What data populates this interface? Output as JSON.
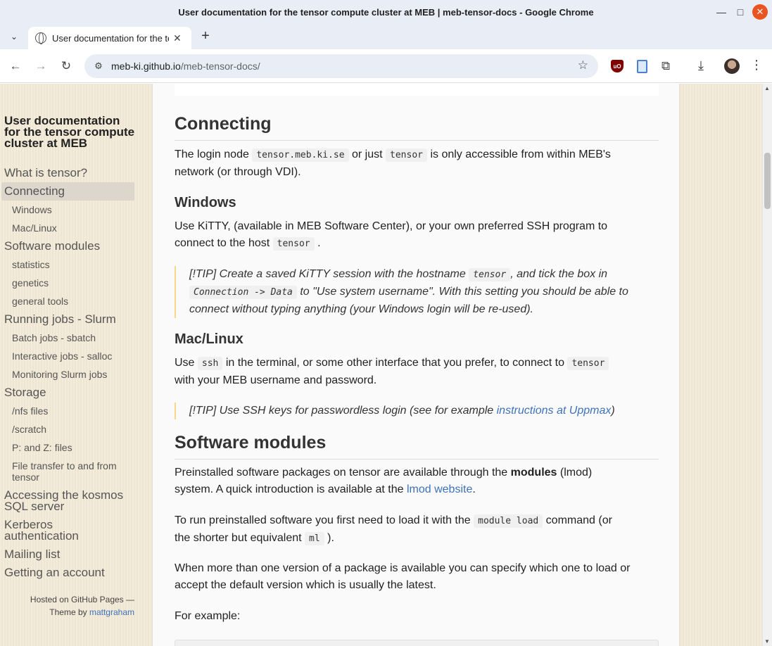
{
  "window": {
    "title": "User documentation for the tensor compute cluster at MEB | meb-tensor-docs - Google Chrome",
    "minimize": "—",
    "maximize": "□",
    "close": "✕"
  },
  "tabs": [
    {
      "title": "User documentation for the tensor compute cluster at MEB",
      "close": "✕"
    }
  ],
  "new_tab": "+",
  "toolbar": {
    "back": "←",
    "forward": "→",
    "reload": "↻",
    "url_host": "meb-ki.github.io",
    "url_path": "/meb-tensor-docs/",
    "bookmark": "☆",
    "ublock_label": "uO",
    "extensions": "⧉",
    "download": "⤓",
    "menu": "⋮"
  },
  "sidebar": {
    "title": "User documentation for the tensor compute cluster at MEB",
    "items": [
      {
        "label": "What is tensor?",
        "level": 1
      },
      {
        "label": "Connecting",
        "level": 1,
        "active": true
      },
      {
        "label": "Windows",
        "level": 2
      },
      {
        "label": "Mac/Linux",
        "level": 2
      },
      {
        "label": "Software modules",
        "level": 1
      },
      {
        "label": "statistics",
        "level": 2
      },
      {
        "label": "genetics",
        "level": 2
      },
      {
        "label": "general tools",
        "level": 2
      },
      {
        "label": "Running jobs - Slurm",
        "level": 1
      },
      {
        "label": "Batch jobs - sbatch",
        "level": 2
      },
      {
        "label": "Interactive jobs - salloc",
        "level": 2
      },
      {
        "label": "Monitoring Slurm jobs",
        "level": 2
      },
      {
        "label": "Storage",
        "level": 1
      },
      {
        "label": "/nfs files",
        "level": 2
      },
      {
        "label": "/scratch",
        "level": 2
      },
      {
        "label": "P: and Z: files",
        "level": 2
      },
      {
        "label": "File transfer to and from tensor",
        "level": 2
      },
      {
        "label": "Accessing the kosmos SQL server",
        "level": 1
      },
      {
        "label": "Kerberos authentication",
        "level": 1
      },
      {
        "label": "Mailing list",
        "level": 1
      },
      {
        "label": "Getting an account",
        "level": 1
      }
    ],
    "footer_line1": "Hosted on GitHub Pages —",
    "footer_theme_prefix": "Theme by",
    "footer_theme_link": "mattgraham"
  },
  "content": {
    "connecting_heading": "Connecting",
    "connecting_p1": "The login node",
    "code_tensor_fqdn": "tensor.meb.ki.se",
    "connecting_p2": "or just",
    "code_tensor": "tensor",
    "connecting_p3": "is only accessible from within MEB's",
    "connecting_p4": "network (or through VDI).",
    "windows_heading": "Windows",
    "windows_p1": "Use KiTTY, (available in MEB Software Center), or your own preferred SSH program to",
    "windows_p2": "connect to the host",
    "windows_p3": ".",
    "tip1_a": "[!TIP] Create a saved KiTTY session with the hostname",
    "tip1_b": ", and tick the box in",
    "code_connection_data": "Connection -> Data",
    "tip1_c": "to \"Use system username\". With this setting you should be able to",
    "tip1_d": "connect without typing anything (your Windows login will be re-used).",
    "mac_heading": "Mac/Linux",
    "mac_p1": "Use",
    "code_ssh": "ssh",
    "mac_p2": "in the terminal, or some other interface that you prefer, to connect to",
    "mac_p3": "with your MEB username and password.",
    "tip2_a": "[!TIP] Use SSH keys for passwordless login (see for example",
    "tip2_link": "instructions at Uppmax",
    "tip2_b": ")",
    "software_heading": "Software modules",
    "sw_p1_a": "Preinstalled software packages on tensor are available through the",
    "sw_p1_bold": "modules",
    "sw_p1_b": "(lmod)",
    "sw_p1_c": "system. A quick introduction is available at the",
    "sw_p1_link": "lmod website",
    "sw_p1_d": ".",
    "sw_p2_a": "To run preinstalled software you first need to load it with the",
    "code_module_load": "module load",
    "sw_p2_b": "command (or",
    "sw_p2_c": "the shorter but equivalent",
    "code_ml": "ml",
    "sw_p2_d": ").",
    "sw_p3_a": "When more than one version of a package is available you can specify which one to load or",
    "sw_p3_b": "accept the default version which is usually the latest.",
    "sw_p4": "For example:"
  }
}
